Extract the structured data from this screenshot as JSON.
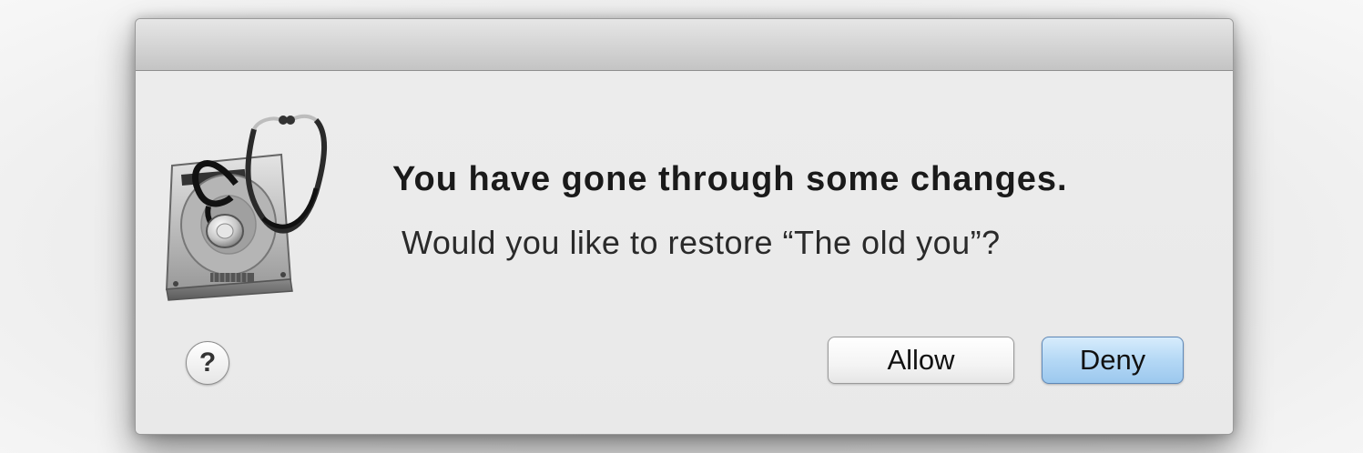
{
  "dialog": {
    "headline": "You have gone through some changes.",
    "message": "Would you like to restore “The old you”?",
    "app_icon": "disk-utility-icon",
    "help_label": "?",
    "buttons": {
      "allow_label": "Allow",
      "deny_label": "Deny"
    },
    "default_button_color": "#a8d0f2"
  }
}
